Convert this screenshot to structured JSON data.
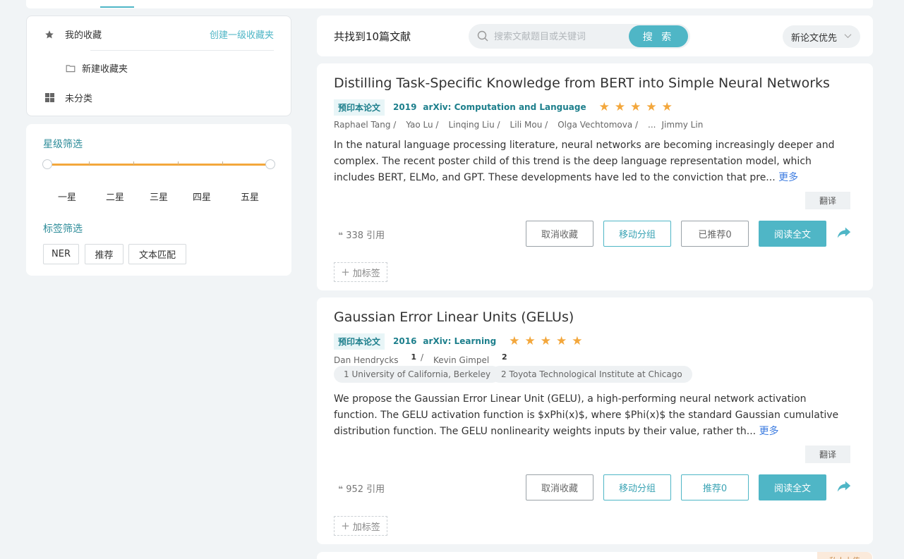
{
  "topbar": {
    "tab_label": ""
  },
  "favorites": {
    "my_favorites": "我的收藏",
    "create_top_folder": "创建一级收藏夹",
    "new_folder": "新建收藏夹",
    "uncategorized": "未分类"
  },
  "filters": {
    "star_filter_title": "星级筛选",
    "star_levels": [
      "一星",
      "二星",
      "三星",
      "四星",
      "五星"
    ],
    "star_range": [
      1,
      5
    ],
    "tag_filter_title": "标签筛选",
    "tags": [
      "NER",
      "推荐",
      "文本匹配"
    ]
  },
  "search": {
    "result_summary": "共找到10篇文献",
    "placeholder": "搜索文献题目或关键词",
    "button": "搜 索",
    "sort": "新论文优先"
  },
  "papers": [
    {
      "title": "Distilling Task-Specific Knowledge from BERT into Simple Neural Networks",
      "type": "预印本论文",
      "year": "2019",
      "venue": "arXiv: Computation and Language",
      "rating": 5,
      "authors": [
        "Raphael Tang /",
        "Yao Lu /",
        "Linqing Liu /",
        "Lili Mou /",
        "Olga Vechtomova /",
        "...",
        "Jimmy Lin"
      ],
      "abstract": "In the natural language processing literature, neural networks are becoming increasingly deeper and complex. The recent poster child of this trend is the deep language representation model, which includes BERT, ELMo, and GPT. These developments have led to the conviction that pre...",
      "more": "更多",
      "translate": "翻译",
      "citations": "338 引用",
      "btn_unfavorite": "取消收藏",
      "btn_move": "移动分组",
      "btn_recommend": "已推荐0",
      "btn_read": "阅读全文",
      "add_tag": "加标签"
    },
    {
      "title": "Gaussian Error Linear Units (GELUs)",
      "type": "预印本论文",
      "year": "2016",
      "venue": "arXiv: Learning",
      "rating": 5,
      "authors": [
        {
          "name": "Dan Hendrycks",
          "sup": "1",
          "sep": "/"
        },
        {
          "name": "Kevin Gimpel",
          "sup": "2",
          "sep": ""
        }
      ],
      "affiliations": [
        "1  University of California, Berkeley",
        "2  Toyota Technological Institute at Chicago"
      ],
      "abstract": "We propose the Gaussian Error Linear Unit (GELU), a high-performing neural network activation function. The GELU activation function is $xPhi(x)$, where $Phi(x)$ the standard Gaussian cumulative distribution function. The GELU nonlinearity weights inputs by their value, rather th...",
      "more": "更多",
      "translate": "翻译",
      "citations": "952 引用",
      "btn_unfavorite": "取消收藏",
      "btn_move": "移动分组",
      "btn_recommend": "推荐0",
      "btn_read": "阅读全文",
      "add_tag": "加标签"
    }
  ],
  "next_card_tag": "私人上传",
  "colors": {
    "accent": "#4fb6c6",
    "star": "#f3a73c",
    "link": "#3b7be0"
  }
}
